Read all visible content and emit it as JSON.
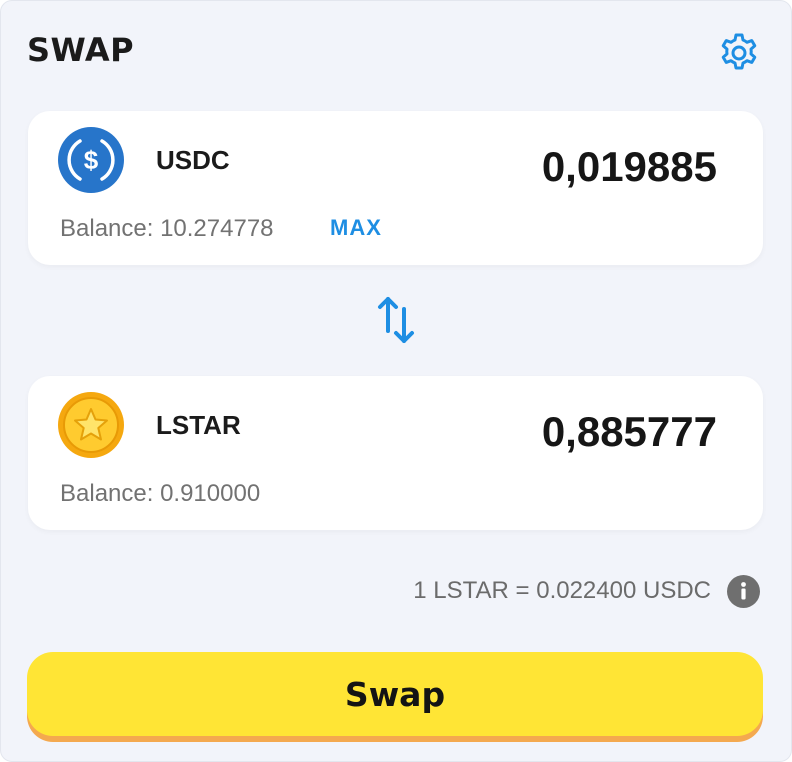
{
  "header": {
    "title": "SWAP",
    "settings_icon": "gear-icon"
  },
  "from_token": {
    "symbol": "USDC",
    "icon": "usdc-coin-icon",
    "amount": "0,019885",
    "balance": "Balance: 10.274778",
    "max_label": "MAX"
  },
  "to_token": {
    "symbol": "LSTAR",
    "icon": "star-coin-icon",
    "amount": "0,885777",
    "balance": "Balance: 0.910000"
  },
  "switch_icon": "swap-arrows-icon",
  "rate": {
    "text": "1 LSTAR = 0.022400 USDC",
    "info_icon": "info-icon"
  },
  "swap_button": {
    "label": "Swap"
  },
  "colors": {
    "accent_blue": "#1e8ee3",
    "usdc_blue": "#2775ca",
    "button_yellow": "#ffe535",
    "button_shadow": "#f4a94f",
    "coin_gold": "#f5b41f",
    "panel_bg": "#f2f4fa"
  }
}
